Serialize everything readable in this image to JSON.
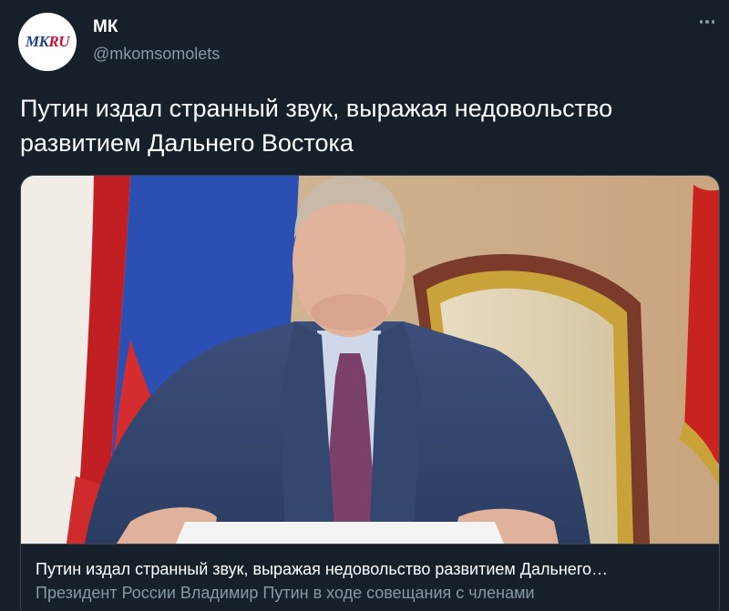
{
  "author": {
    "name": "МК",
    "handle": "@mkomsomolets",
    "avatar_logo": {
      "left": "MK",
      "right": "RU"
    },
    "avatar_icon": "mkru-logo"
  },
  "menu_icon": "more-dots-icon",
  "tweet": {
    "text": "Путин издал странный звук, выражая недовольство развитием Дальнего Востока"
  },
  "card": {
    "image_description_icon": "news-photo",
    "title": "Путин издал странный звук, выражая недовольство развитием Дальнего…",
    "description": "Президент России Владимир Путин в ходе совещания с членами"
  },
  "colors": {
    "background": "#15202b",
    "text": "#ffffff",
    "secondary_text": "#8899a6",
    "border": "#38444d"
  }
}
